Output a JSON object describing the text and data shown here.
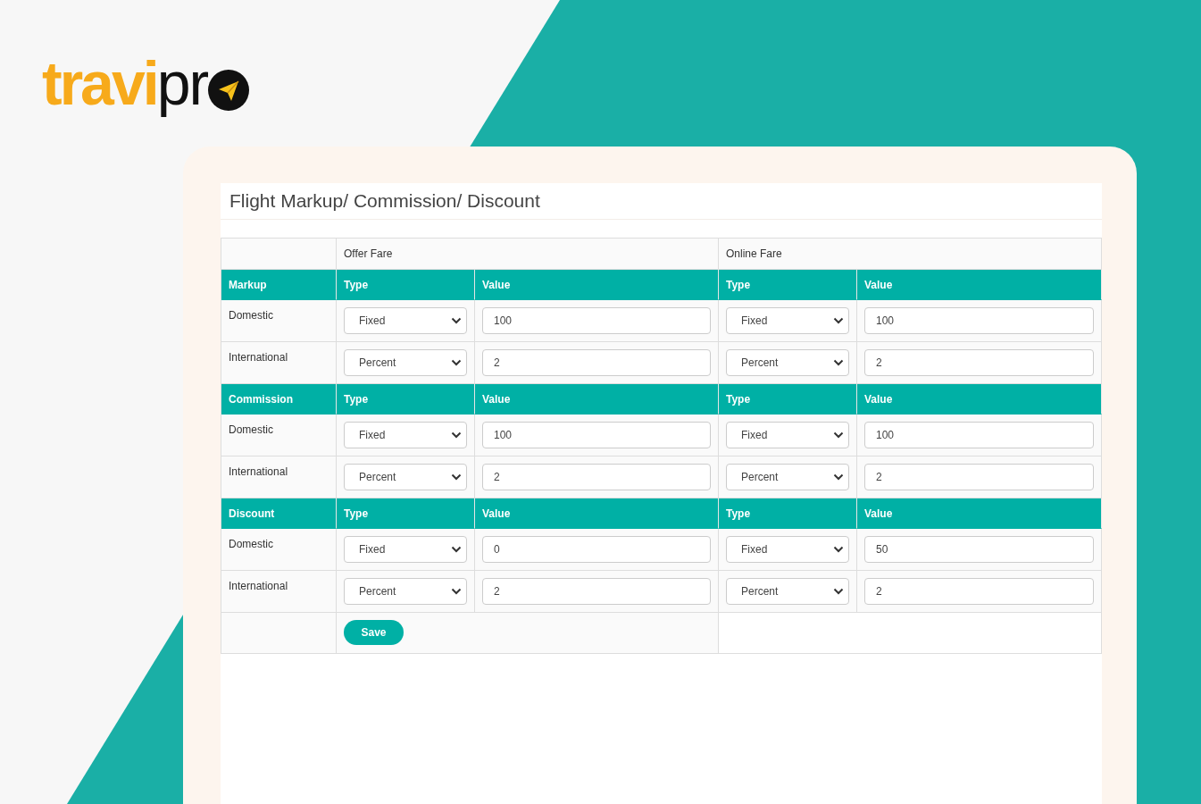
{
  "logo": {
    "text_main": "travi",
    "text_end": "pr"
  },
  "title": "Flight Markup/ Commission/ Discount",
  "fare_groups": [
    "Offer Fare",
    "Online Fare"
  ],
  "sections": [
    {
      "name": "Markup",
      "columns": [
        "Type",
        "Value",
        "Type",
        "Value"
      ],
      "rows": [
        {
          "label": "Domestic",
          "offer_type": "Fixed",
          "offer_value": "100",
          "online_type": "Fixed",
          "online_value": "100"
        },
        {
          "label": "International",
          "offer_type": "Percent",
          "offer_value": "2",
          "online_type": "Percent",
          "online_value": "2"
        }
      ]
    },
    {
      "name": "Commission",
      "columns": [
        "Type",
        "Value",
        "Type",
        "Value"
      ],
      "rows": [
        {
          "label": "Domestic",
          "offer_type": "Fixed",
          "offer_value": "100",
          "online_type": "Fixed",
          "online_value": "100"
        },
        {
          "label": "International",
          "offer_type": "Percent",
          "offer_value": "2",
          "online_type": "Percent",
          "online_value": "2"
        }
      ]
    },
    {
      "name": "Discount",
      "columns": [
        "Type",
        "Value",
        "Type",
        "Value"
      ],
      "rows": [
        {
          "label": "Domestic",
          "offer_type": "Fixed",
          "offer_value": "0",
          "online_type": "Fixed",
          "online_value": "50"
        },
        {
          "label": "International",
          "offer_type": "Percent",
          "offer_value": "2",
          "online_type": "Percent",
          "online_value": "2"
        }
      ]
    }
  ],
  "save_button": "Save"
}
